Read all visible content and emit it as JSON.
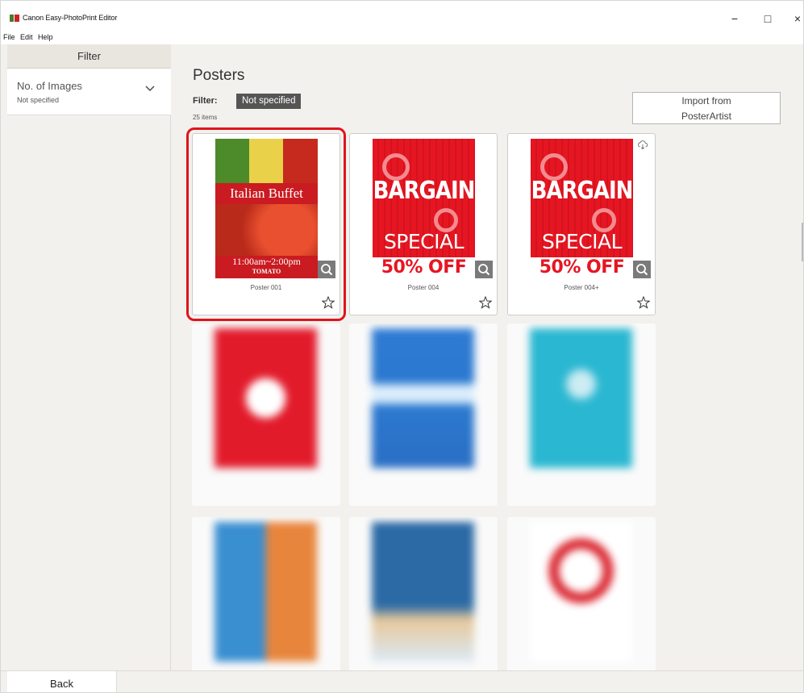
{
  "window": {
    "title": "Canon Easy-PhotoPrint Editor",
    "minimize": "−",
    "maximize": "□",
    "close": "×"
  },
  "menu": [
    "File",
    "Edit",
    "Help"
  ],
  "sidebar": {
    "header": "Filter",
    "filter": {
      "label": "No. of Images",
      "value": "Not specified"
    }
  },
  "main": {
    "title": "Posters",
    "filter_label": "Filter:",
    "filter_value": "Not specified",
    "count": "25 items",
    "import_button": {
      "line1": "Import from",
      "line2": "PosterArtist"
    }
  },
  "cards": [
    {
      "label": "Poster 001",
      "poster": {
        "title": "Italian Buffet",
        "time": "11:00am~2:00pm",
        "brand": "TOMATO"
      },
      "selected": true
    },
    {
      "label": "Poster 004",
      "poster": {
        "line1": "BARGAIN",
        "line2": "SPECIAL",
        "line3": "50% OFF"
      },
      "selected": false
    },
    {
      "label": "Poster 004+",
      "poster": {
        "line1": "BARGAIN",
        "line2": "SPECIAL",
        "line3": "50% OFF"
      },
      "selected": false,
      "cloud": true
    }
  ],
  "icons": {
    "zoom": "magnifier-icon",
    "favorite": "star-outline-icon",
    "cloud": "cloud-download-icon",
    "expand": "chevron-down-icon"
  },
  "colors": {
    "selection": "#e0141c",
    "accent_red": "#e51622",
    "filter_tag_bg": "#555555"
  },
  "footer": {
    "back": "Back"
  }
}
